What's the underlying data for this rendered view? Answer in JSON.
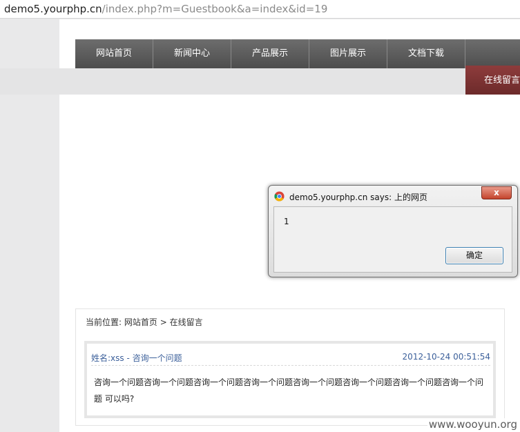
{
  "address_bar": {
    "host": "demo5.yourphp.cn",
    "path": "/index.php?m=Guestbook&a=index&id=19"
  },
  "nav": {
    "items": [
      "网站首页",
      "新闻中心",
      "产品展示",
      "图片展示",
      "文档下载"
    ],
    "active_tab": "在线留言"
  },
  "breadcrumb": {
    "prefix": "当前位置:",
    "home": "网站首页",
    "separator": ">",
    "current": "在线留言"
  },
  "message": {
    "name_title": "姓名:xss - 咨询一个问题",
    "time": "2012-10-24 00:51:54",
    "body": "咨询一个问题咨询一个问题咨询一个问题咨询一个问题咨询一个问题咨询一个问题咨询一个问题咨询一个问题 可以吗?"
  },
  "dialog": {
    "title": "demo5.yourphp.cn says: 上的网页",
    "message": "1",
    "ok_label": "确定",
    "close_label": "x"
  },
  "watermark": "www.wooyun.org",
  "colors": {
    "nav_bg": "#5a5a5a",
    "active_tab_bg": "#7a3232",
    "link_blue": "#3b5f9a",
    "ok_border": "#3c7fb1"
  }
}
